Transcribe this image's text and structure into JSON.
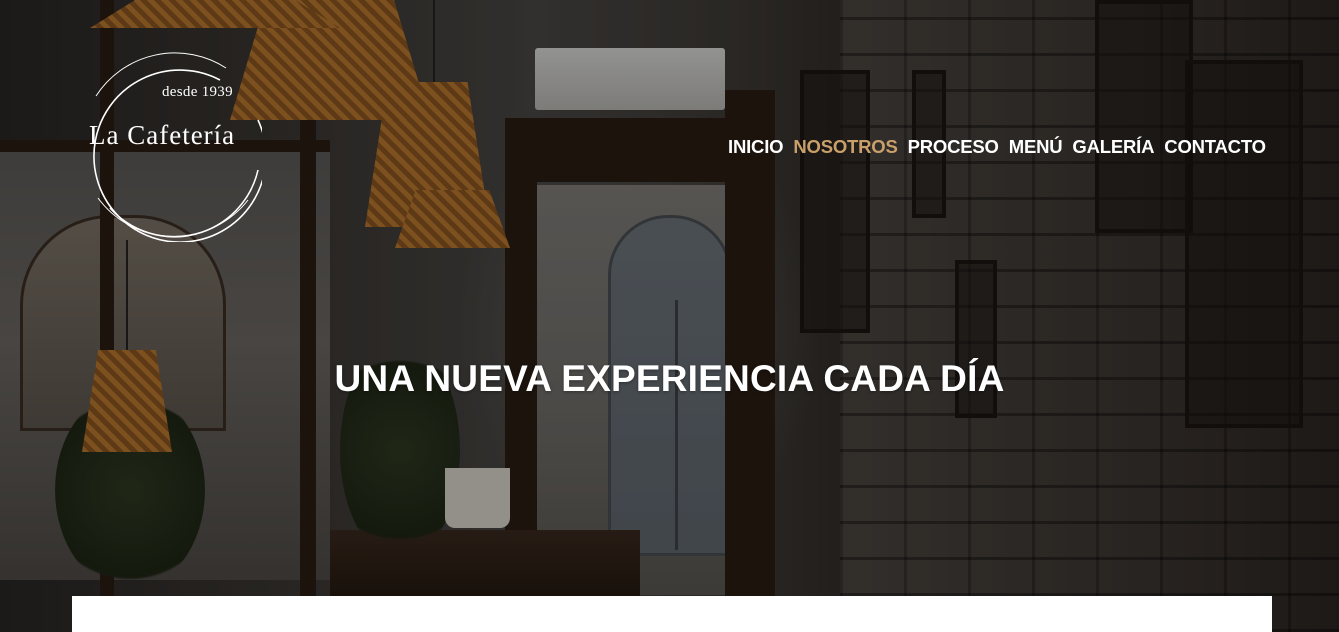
{
  "brand": {
    "tagline": "desde 1939",
    "name": "La Cafetería"
  },
  "nav": {
    "items": [
      {
        "label": "INICIO",
        "active": false
      },
      {
        "label": "NOSOTROS",
        "active": true
      },
      {
        "label": "PROCESO",
        "active": false
      },
      {
        "label": "MENÚ",
        "active": false
      },
      {
        "label": "GALERÍA",
        "active": false
      },
      {
        "label": "CONTACTO",
        "active": false
      }
    ]
  },
  "hero": {
    "title": "UNA NUEVA EXPERIENCIA CADA DÍA"
  },
  "colors": {
    "nav_active": "#c9a06a",
    "nav_text": "#ffffff",
    "card_background": "#ffffff"
  }
}
